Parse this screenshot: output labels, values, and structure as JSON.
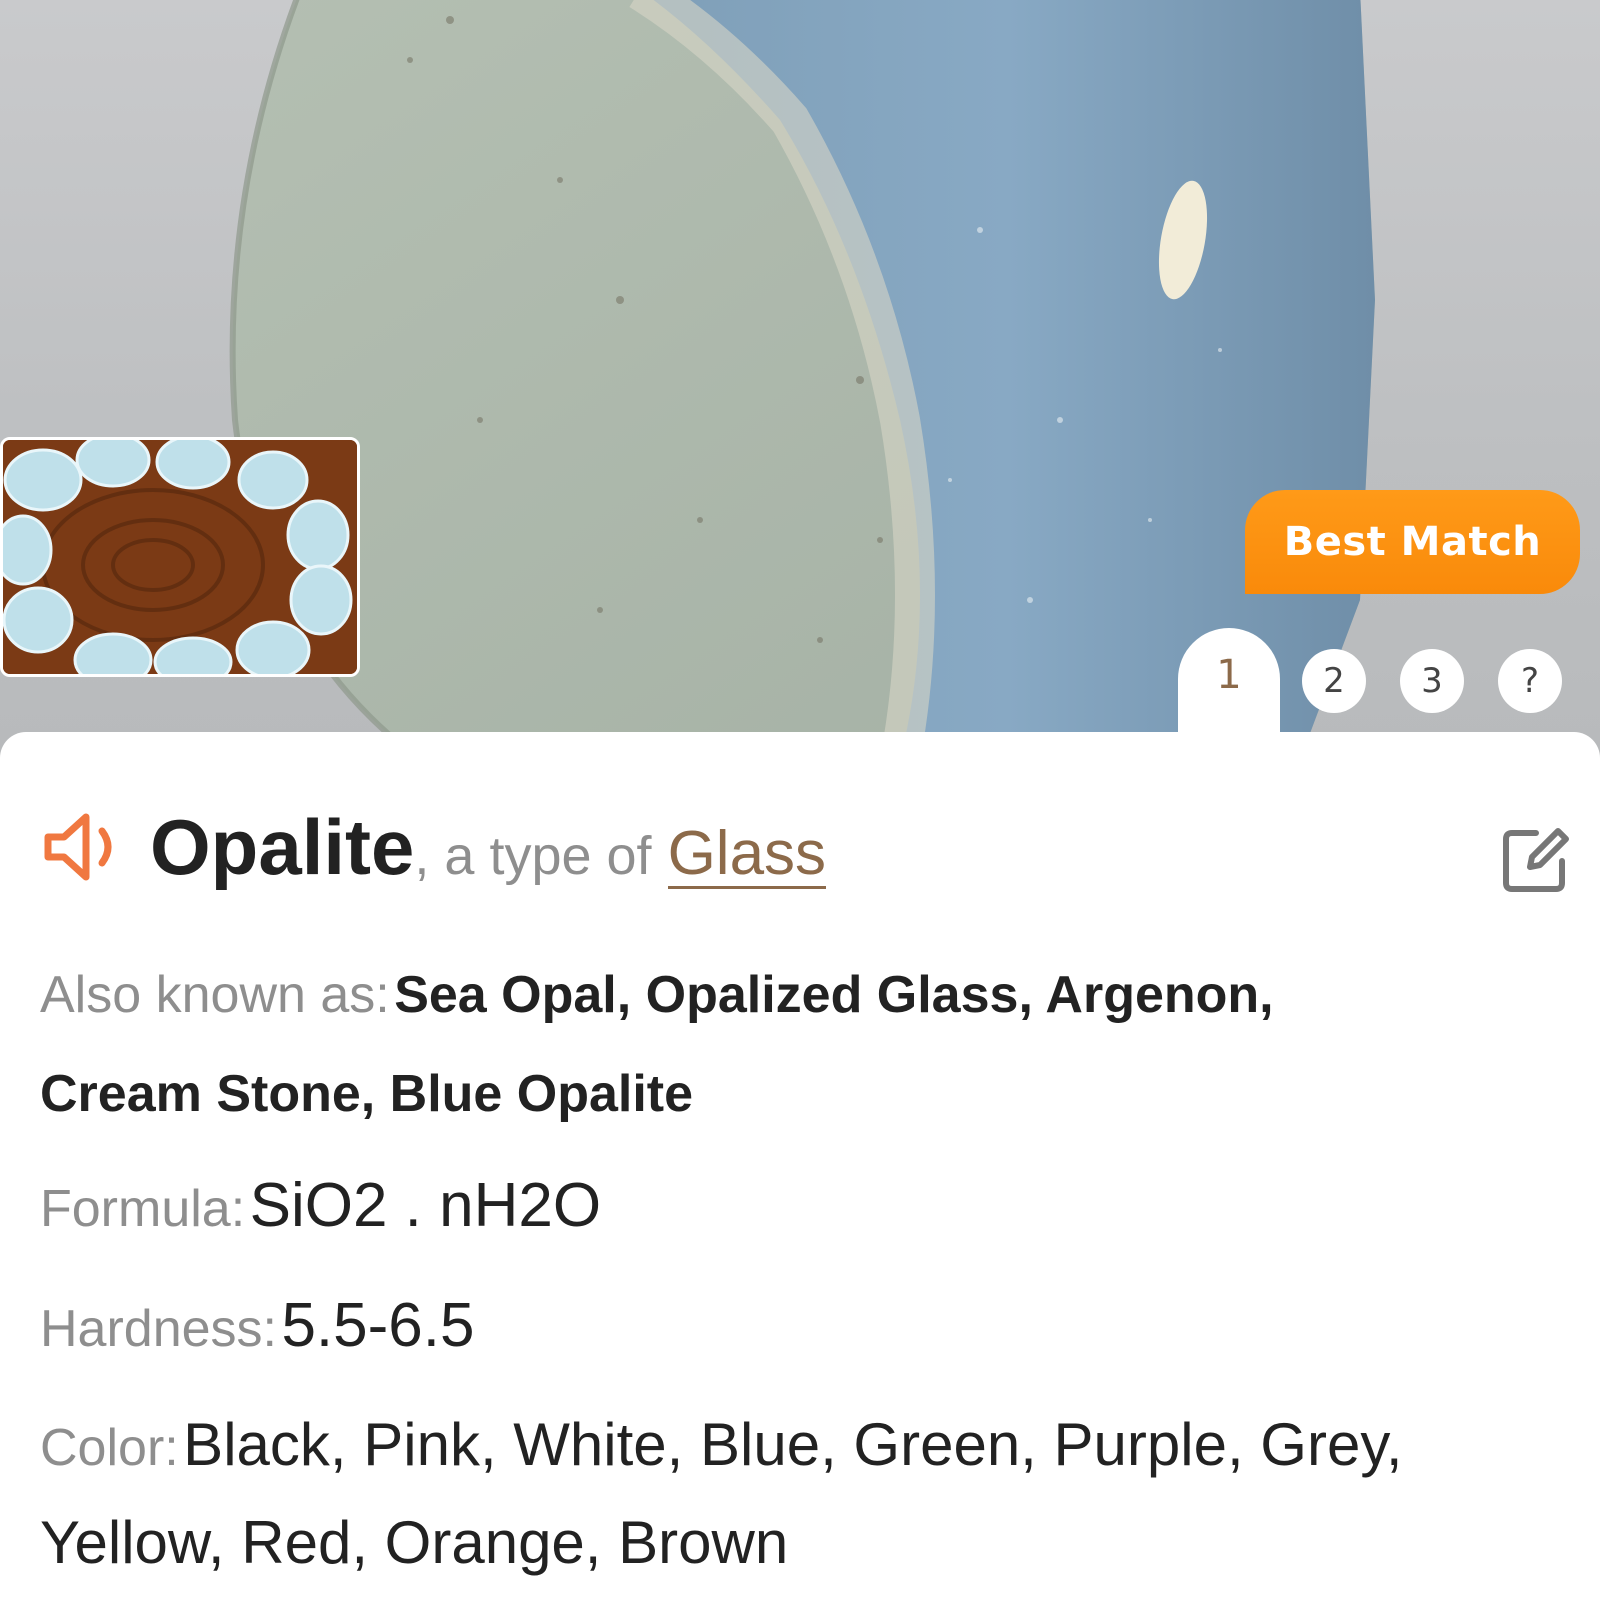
{
  "result": {
    "badge": "Best Match",
    "tabs": [
      "1",
      "2",
      "3",
      "?"
    ],
    "active_tab": 0
  },
  "stone": {
    "name": "Opalite",
    "type_prefix": ", a type of ",
    "type_link": "Glass"
  },
  "details": {
    "aka_label": "Also known as:",
    "aka_line1": "Sea Opal, Opalized Glass, Argenon,",
    "aka_line2": "Cream Stone, Blue Opalite",
    "formula_label": "Formula:",
    "formula_value": "SiO2 . nH2O",
    "hardness_label": "Hardness:",
    "hardness_value": "5.5-6.5",
    "color_label": "Color:",
    "color_line1": "Black, Pink, White, Blue, Green, Purple, Grey,",
    "color_line2": "Yellow, Red, Orange, Brown"
  },
  "icons": {
    "speaker": "speaker-icon",
    "edit": "edit-icon"
  },
  "colors": {
    "accent": "#f98a0a",
    "speaker": "#f07840",
    "link": "#8c6a4a"
  }
}
